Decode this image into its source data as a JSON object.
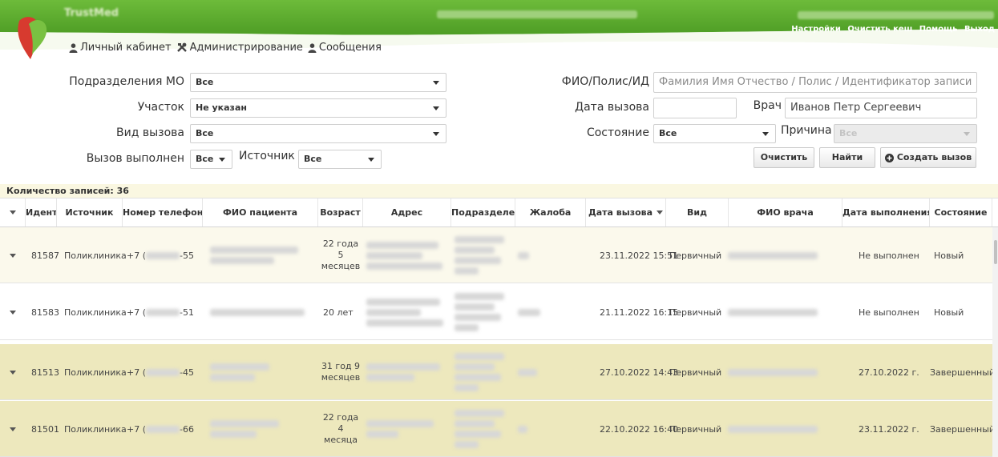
{
  "header": {
    "brand": "TrustMed",
    "top_links": [
      "Настройки",
      "Очистить кеш",
      "Помощь",
      "Выход"
    ],
    "nav": [
      {
        "label": "Личный кабинет",
        "icon": "user-icon"
      },
      {
        "label": "Администрирование",
        "icon": "tools-icon"
      },
      {
        "label": "Сообщения",
        "icon": "user-icon"
      }
    ],
    "colors": {
      "banner_green": "#5cac2e",
      "logo_red": "#d73a2f",
      "logo_green": "#79c142"
    }
  },
  "filters": {
    "departments": {
      "label": "Подразделения МО",
      "value": "Все"
    },
    "district": {
      "label": "Участок",
      "value": "Не указан"
    },
    "call_type": {
      "label": "Вид вызова",
      "value": "Все"
    },
    "completed": {
      "label": "Вызов выполнен",
      "value": "Все"
    },
    "source": {
      "label": "Источник",
      "value": "Все"
    },
    "search": {
      "label": "ФИО/Полис/ИД",
      "placeholder": "Фамилия Имя Отчество / Полис / Идентификатор записи"
    },
    "call_date": {
      "label": "Дата вызова",
      "value": ""
    },
    "doctor": {
      "label": "Врач",
      "value": "Иванов Петр Сергеевич"
    },
    "state": {
      "label": "Состояние",
      "value": "Все"
    },
    "reason": {
      "label": "Причина",
      "value": "Все"
    },
    "buttons": {
      "clear": "Очистить",
      "find": "Найти",
      "create": "Создать вызов"
    }
  },
  "table": {
    "count_label": "Количество записей: 36",
    "columns": [
      "Идент",
      "Источник",
      "Номер телефона г",
      "ФИО пациента",
      "Возраст",
      "Адрес",
      "Подразделен",
      "Жалоба",
      "Дата вызова",
      "Вид",
      "ФИО врача",
      "Дата выполнения",
      "Состояние"
    ],
    "rows": [
      {
        "id": "81587",
        "source": "Поликлиника",
        "phone_prefix": "+7 (",
        "phone_suffix": "-55",
        "age": "22 года 5 месяцев",
        "call_date": "23.11.2022 15:51",
        "type": "Первичный",
        "done_date": "Не выполнен",
        "state": "Новый"
      },
      {
        "id": "81583",
        "source": "Поликлиника",
        "phone_prefix": "+7 (",
        "phone_suffix": "-51",
        "age": "20 лет",
        "call_date": "21.11.2022 16:15",
        "type": "Первичный",
        "done_date": "Не выполнен",
        "state": "Новый"
      },
      {
        "id": "81513",
        "source": "Поликлиника",
        "phone_prefix": "+7 (",
        "phone_suffix": "-45",
        "age": "31 год 9 месяцев",
        "call_date": "27.10.2022 14:43",
        "type": "Первичный",
        "done_date": "27.10.2022 г.",
        "state": "Завершенный"
      },
      {
        "id": "81501",
        "source": "Поликлиника",
        "phone_prefix": "+7 (",
        "phone_suffix": "-66",
        "age": "22 года 4 месяца",
        "call_date": "22.10.2022 16:40",
        "type": "Первичный",
        "done_date": "23.11.2022 г.",
        "state": "Завершенный"
      }
    ]
  }
}
